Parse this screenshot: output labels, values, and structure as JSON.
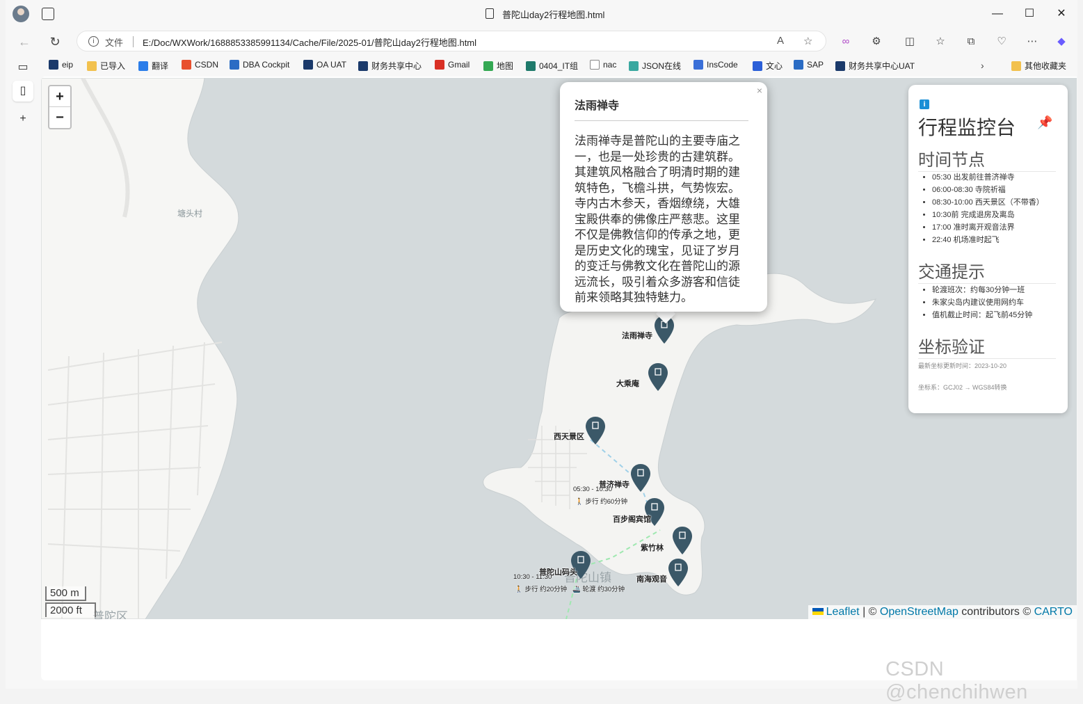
{
  "window": {
    "tab_title": "普陀山day2行程地图.html",
    "controls": [
      "—",
      "☐",
      "✕"
    ]
  },
  "address_bar": {
    "scheme_label": "文件",
    "url": "E:/Doc/WXWork/1688853385991134/Cache/File/2025-01/普陀山day2行程地图.html"
  },
  "bookmarks": [
    {
      "label": "eip",
      "icon": "eip-icon",
      "color": "#1b3a6b"
    },
    {
      "label": "已导入",
      "icon": "folder-icon",
      "color": "#f2c14e"
    },
    {
      "label": "翻译",
      "icon": "translate-icon",
      "color": "#2b7de9"
    },
    {
      "label": "CSDN",
      "icon": "csdn-icon",
      "color": "#e8502e"
    },
    {
      "label": "DBA Cockpit",
      "icon": "sap-icon",
      "color": "#2b6cc4"
    },
    {
      "label": "OA UAT",
      "icon": "oa-icon",
      "color": "#1b3a6b"
    },
    {
      "label": "财务共享中心",
      "icon": "finance-icon",
      "color": "#1b3a6b"
    },
    {
      "label": "Gmail",
      "icon": "gmail-icon",
      "color": "#d93025"
    },
    {
      "label": "地图",
      "icon": "map-icon",
      "color": "#34a853"
    },
    {
      "label": "0404_IT组",
      "icon": "group-icon",
      "color": "#1f7a6b"
    },
    {
      "label": "nac",
      "icon": "page-icon",
      "color": "#888888"
    },
    {
      "label": "JSON在线",
      "icon": "json-icon",
      "color": "#3aa8a0"
    },
    {
      "label": "InsCode",
      "icon": "inscode-icon",
      "color": "#3a6fd8"
    },
    {
      "label": "文心",
      "icon": "wenxin-icon",
      "color": "#2b5fd8"
    },
    {
      "label": "SAP",
      "icon": "sap-icon",
      "color": "#2b6cc4"
    },
    {
      "label": "财务共享中心UAT",
      "icon": "finance-icon",
      "color": "#1b3a6b"
    },
    {
      "label": "其他收藏夹",
      "icon": "folder-icon",
      "color": "#f2c14e"
    }
  ],
  "map": {
    "zoom_in": "+",
    "zoom_out": "−",
    "scale_metric": "500 m",
    "scale_imperial": "2000 ft",
    "place_labels": {
      "village": "塘头村",
      "town": "普陀山镇",
      "district": "普陀区"
    },
    "attribution": {
      "leaflet": "Leaflet",
      "sep1": " | © ",
      "osm": "OpenStreetMap",
      "mid": " contributors © ",
      "carto": "CARTO"
    },
    "markers": [
      {
        "name": "法雨禅寺"
      },
      {
        "name": "大乘庵"
      },
      {
        "name": "西天景区"
      },
      {
        "name": "普济禅寺"
      },
      {
        "name": "百步阁宾馆"
      },
      {
        "name": "紫竹林"
      },
      {
        "name": "普陀山码头"
      },
      {
        "name": "南海观音"
      }
    ],
    "marker_color": "#3b5868",
    "route_labels": {
      "r1_time": "05:30 - 10:30",
      "r1_mode": "🚶 步行 约60分钟",
      "r2_time": "10:30 - 11:30",
      "r2_mode": "🚶 步行 约20分钟",
      "r2_ferry": "🚢 轮渡 约30分钟"
    }
  },
  "popup": {
    "title": "法雨禅寺",
    "close": "×",
    "body": "法雨禅寺是普陀山的主要寺庙之一，也是一处珍贵的古建筑群。其建筑风格融合了明清时期的建筑特色，飞檐斗拱，气势恢宏。寺内古木参天，香烟缭绕，大雄宝殿供奉的佛像庄严慈悲。这里不仅是佛教信仰的传承之地，更是历史文化的瑰宝，见证了岁月的变迁与佛教文化在普陀山的源远流长，吸引着众多游客和信徒前来领略其独特魅力。"
  },
  "panel": {
    "info_icon": "i",
    "title": "行程监控台",
    "pin_icon": "📌",
    "section_time": "时间节点",
    "time_items": [
      "05:30 出发前往普济禅寺",
      "06:00-08:30 寺院祈福",
      "08:30-10:00 西天景区（不带香）",
      "10:30前 完成退房及离岛",
      "17:00 准时离开观音法界",
      "22:40 机场准时起飞"
    ],
    "section_traffic": "交通提示",
    "traffic_items": [
      "轮渡班次：约每30分钟一班",
      "朱家尖岛内建议使用网约车",
      "值机截止时间：起飞前45分钟"
    ],
    "section_coord": "坐标验证",
    "coord_updated": "最新坐标更新时间：2023-10-20",
    "coord_system": "坐标系：GCJ02 → WGS84转换"
  },
  "watermark": "CSDN @chenchihwen"
}
